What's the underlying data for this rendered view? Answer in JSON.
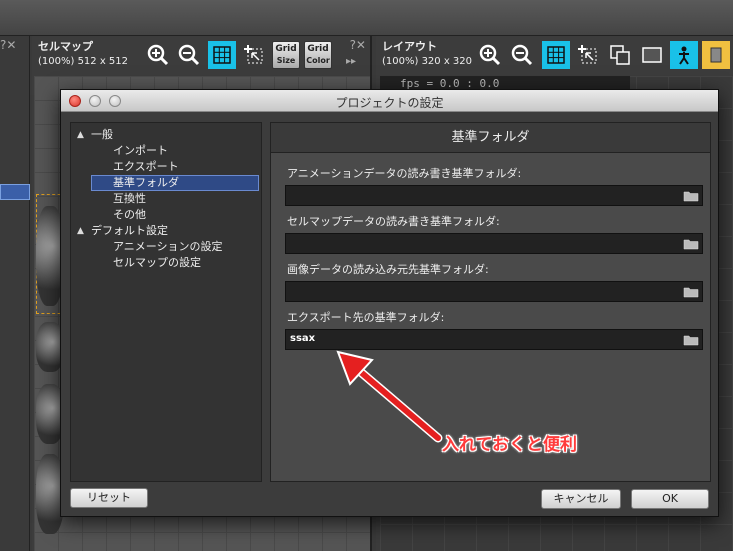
{
  "background": {
    "left_panel_controls": "?✕",
    "cellmap_panel": {
      "title": "セルマップ",
      "size": "(100%) 512 x 512",
      "grid_size_label": [
        "Grid",
        "Size"
      ],
      "grid_color_label": [
        "Grid",
        "Color"
      ],
      "controls": "?✕",
      "ff": "▸▸"
    },
    "layout_panel": {
      "title": "レイアウト",
      "size": "(100%) 320 x 320",
      "fps": "fps = 0.0 : 0.0"
    }
  },
  "dialog": {
    "title": "プロジェクトの設定",
    "tree": [
      {
        "label": "一般",
        "level": 0,
        "expanded": true
      },
      {
        "label": "インポート",
        "level": 1
      },
      {
        "label": "エクスポート",
        "level": 1
      },
      {
        "label": "基準フォルダ",
        "level": 1,
        "selected": true
      },
      {
        "label": "互換性",
        "level": 1
      },
      {
        "label": "その他",
        "level": 1
      },
      {
        "label": "デフォルト設定",
        "level": 0,
        "expanded": true
      },
      {
        "label": "アニメーションの設定",
        "level": 1
      },
      {
        "label": "セルマップの設定",
        "level": 1
      }
    ],
    "content_title": "基準フォルダ",
    "fields": [
      {
        "label": "アニメーションデータの読み書き基準フォルダ:",
        "value": ""
      },
      {
        "label": "セルマップデータの読み書き基準フォルダ:",
        "value": ""
      },
      {
        "label": "画像データの読み込み元先基準フォルダ:",
        "value": ""
      },
      {
        "label": "エクスポート先の基準フォルダ:",
        "value": "ssax"
      }
    ],
    "buttons": {
      "reset": "リセット",
      "cancel": "キャンセル",
      "ok": "OK"
    }
  },
  "annotation": {
    "text": "入れておくと便利",
    "color": "#ff3b3b"
  },
  "colors": {
    "accent_tool": "#19c1e8",
    "selection": "#2f4a86"
  }
}
